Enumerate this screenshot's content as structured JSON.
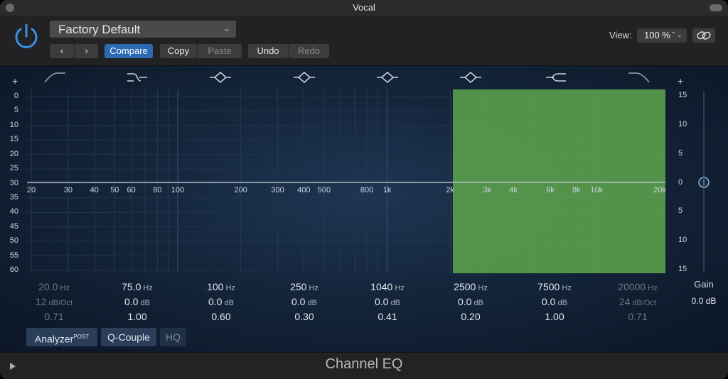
{
  "window": {
    "title": "Vocal"
  },
  "header": {
    "preset": "Factory Default",
    "compare_label": "Compare",
    "copy_label": "Copy",
    "paste_label": "Paste",
    "undo_label": "Undo",
    "redo_label": "Redo",
    "view_label": "View:",
    "view_value": "100 %"
  },
  "graph": {
    "left_scale": [
      "0",
      "5",
      "10",
      "15",
      "20",
      "25",
      "30",
      "35",
      "40",
      "45",
      "50",
      "55",
      "60"
    ],
    "right_scale": [
      "15",
      "10",
      "5",
      "0",
      "5",
      "10",
      "15"
    ],
    "freq_labels": [
      "20",
      "30",
      "40",
      "50",
      "60",
      "80",
      "100",
      "200",
      "300",
      "400",
      "500",
      "800",
      "1k",
      "2k",
      "3k",
      "4k",
      "6k",
      "8k",
      "10k",
      "20k"
    ],
    "highlight_color": "#5a9e4c",
    "gain_marker_db": 0
  },
  "bands": [
    {
      "freq": "20.0",
      "freq_unit": "Hz",
      "gain": "12",
      "gain_unit": "dB/Oct",
      "q": "0.71",
      "active": false,
      "shape": "low-cut-icon"
    },
    {
      "freq": "75.0",
      "freq_unit": "Hz",
      "gain": "0.0",
      "gain_unit": "dB",
      "q": "1.00",
      "active": true,
      "shape": "low-shelf-icon"
    },
    {
      "freq": "100",
      "freq_unit": "Hz",
      "gain": "0.0",
      "gain_unit": "dB",
      "q": "0.60",
      "active": true,
      "shape": "bell-icon"
    },
    {
      "freq": "250",
      "freq_unit": "Hz",
      "gain": "0.0",
      "gain_unit": "dB",
      "q": "0.30",
      "active": true,
      "shape": "bell-icon"
    },
    {
      "freq": "1040",
      "freq_unit": "Hz",
      "gain": "0.0",
      "gain_unit": "dB",
      "q": "0.41",
      "active": true,
      "shape": "bell-icon"
    },
    {
      "freq": "2500",
      "freq_unit": "Hz",
      "gain": "0.0",
      "gain_unit": "dB",
      "q": "0.20",
      "active": true,
      "shape": "bell-icon"
    },
    {
      "freq": "7500",
      "freq_unit": "Hz",
      "gain": "0.0",
      "gain_unit": "dB",
      "q": "1.00",
      "active": true,
      "shape": "high-shelf-icon"
    },
    {
      "freq": "20000",
      "freq_unit": "Hz",
      "gain": "24",
      "gain_unit": "dB/Oct",
      "q": "0.71",
      "active": false,
      "shape": "high-cut-icon"
    }
  ],
  "gain": {
    "label": "Gain",
    "value": "0.0 dB"
  },
  "toolbar": {
    "analyzer_label": "Analyzer",
    "analyzer_sup": "POST",
    "qcouple_label": "Q-Couple",
    "hq_label": "HQ"
  },
  "footer": {
    "plugin_name": "Channel EQ"
  }
}
